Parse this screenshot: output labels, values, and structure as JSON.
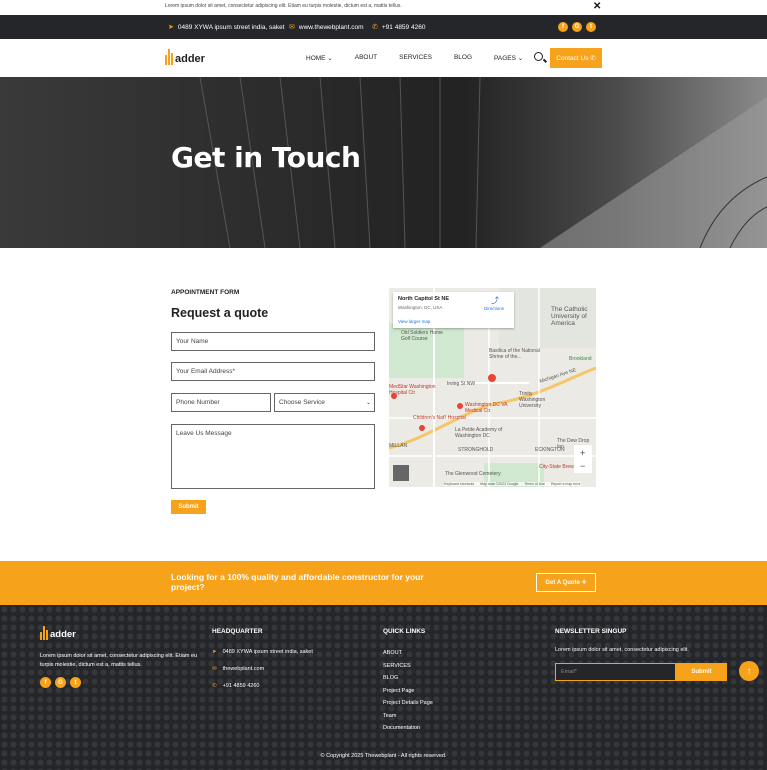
{
  "announcement": {
    "text": "Lorem ipsum dolor sit amet, consectetur adipiscing elit. Etiam eu turpis molestie, dictum est a, mattis tellus.",
    "close": "✕"
  },
  "topbar": {
    "address": "0489 XYWA ipsum street india, saket",
    "website": "www.thewebplant.com",
    "phone": "+91 4859 4260",
    "social": [
      "f",
      "G",
      "t"
    ]
  },
  "header": {
    "logo_text": "adder",
    "nav": [
      "HOME ⌄",
      "ABOUT",
      "SERVICES",
      "BLOG",
      "PAGES ⌄"
    ],
    "contact_label": "Contact Us ✆"
  },
  "hero": {
    "title": "Get in Touch"
  },
  "form": {
    "section_label": "APPOINTMENT FORM",
    "title": "Request a quote",
    "name_placeholder": "Your Name",
    "email_placeholder": "Your Email Address*",
    "phone_placeholder": "Phone Number",
    "service_selected": "Choose Service",
    "message_placeholder": "Leave Us Message",
    "submit_label": "Submit"
  },
  "map": {
    "card_title": "North Capitol St NE",
    "card_sub": "Washington, DC, USA",
    "card_link": "View larger map",
    "directions": "Directions",
    "labels": {
      "catholic": "The Catholic University of America",
      "golf": "Old Soldiers Home Golf Course",
      "basilica": "Basilica of the National Shrine of the...",
      "brookland": "Brookland",
      "medstar": "MedStar Washington Hospital Ctr",
      "va": "Washington DC VA Medical Ctr",
      "trinity": "Trinity Washington University",
      "childrens": "Children's Nat'l Hospital",
      "lapetite": "La Petite Academy of Washington DC",
      "stronghold": "STRONGHOLD",
      "eckington": "ECKINGTON",
      "millan": "MILLAN",
      "glenwood": "The Glenwood Cemetery",
      "dewdrop": "The Dew Drop Inn",
      "citystate": "City-State Brew",
      "irving": "Irving St NW",
      "michigan": "Michigan Ave NE",
      "footer_keyboard": "Keyboard shortcuts",
      "footer_data": "Map data ©2023 Google",
      "footer_terms": "Terms of Use",
      "footer_report": "Report a map error",
      "zoom_in": "+",
      "zoom_out": "−"
    }
  },
  "cta": {
    "text": "Looking for a 100% quality and affordable constructor for your project?",
    "button": "Get A Quote ✛"
  },
  "footer": {
    "logo_text": "adder",
    "about": "Lorem ipsum dolor sit amet, consectetur adipiscing elit. Etiam eu turpis molestie, dictum est a, mattis tellus.",
    "social": [
      "f",
      "G",
      "t"
    ],
    "hq_title": "HEADQUARTER",
    "hq_address": "0489 XYWA ipsum street india, saket",
    "hq_website": "thewebplant.com",
    "hq_phone": "+91 4859 4260",
    "links_title": "QUICK LINKS",
    "links": [
      "ABOUT",
      "SERVICES",
      "BLOG",
      "Project Page",
      "Project Details Page",
      "Team",
      "Documentation"
    ],
    "news_title": "NEWSLETTER SINGUP",
    "news_text": "Lorem ipsum dolor sit amet, consectetur adipiscing elit.",
    "news_placeholder": "Email*",
    "news_submit": "Submit",
    "copyright": "© Copyright 2025 Thewebplant - All rights reserved."
  },
  "colors": {
    "accent": "#f7a21b",
    "dark": "#24262a"
  }
}
